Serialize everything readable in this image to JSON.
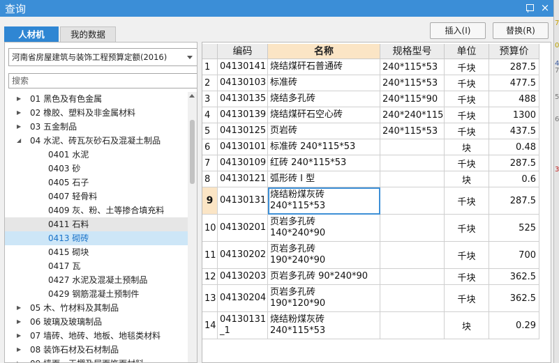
{
  "window": {
    "title": "查询",
    "close_glyph": "×"
  },
  "tabs": [
    {
      "label": "人材机"
    },
    {
      "label": "我的数据"
    }
  ],
  "buttons": {
    "insert": "插入(I)",
    "replace": "替换(R)"
  },
  "quota_select": {
    "value": "河南省房屋建筑与装饰工程预算定额(2016)"
  },
  "search": {
    "placeholder": "搜索"
  },
  "tree": [
    {
      "label": "01 黑色及有色金属",
      "level": 0,
      "state": ""
    },
    {
      "label": "02 橡胶、塑料及非金属材料",
      "level": 0,
      "state": ""
    },
    {
      "label": "03 五金制品",
      "level": 0,
      "state": ""
    },
    {
      "label": "04 水泥、砖瓦灰砂石及混凝土制品",
      "level": 0,
      "state": "expanded"
    },
    {
      "label": "0401 水泥",
      "level": 1,
      "state": ""
    },
    {
      "label": "0403 砂",
      "level": 1,
      "state": ""
    },
    {
      "label": "0405 石子",
      "level": 1,
      "state": ""
    },
    {
      "label": "0407 轻骨料",
      "level": 1,
      "state": ""
    },
    {
      "label": "0409 灰、粉、土等掺合填充料",
      "level": 1,
      "state": ""
    },
    {
      "label": "0411 石料",
      "level": 1,
      "state": "hover"
    },
    {
      "label": "0413 砌砖",
      "level": 1,
      "state": "selected"
    },
    {
      "label": "0415 砌块",
      "level": 1,
      "state": ""
    },
    {
      "label": "0417 瓦",
      "level": 1,
      "state": ""
    },
    {
      "label": "0427 水泥及混凝土预制品",
      "level": 1,
      "state": ""
    },
    {
      "label": "0429 钢筋混凝土预制件",
      "level": 1,
      "state": ""
    },
    {
      "label": "05 木、竹材料及其制品",
      "level": 0,
      "state": ""
    },
    {
      "label": "06 玻璃及玻璃制品",
      "level": 0,
      "state": ""
    },
    {
      "label": "07 墙砖、地砖、地板、地毯类材料",
      "level": 0,
      "state": ""
    },
    {
      "label": "08 装饰石材及石材制品",
      "level": 0,
      "state": ""
    },
    {
      "label": "09 墙面、天棚及屋面饰面材料",
      "level": 0,
      "state": ""
    }
  ],
  "grid": {
    "columns": [
      "",
      "编码",
      "名称",
      "规格型号",
      "单位",
      "预算价"
    ],
    "current_row": 9,
    "rows": [
      {
        "idx": "1",
        "code": "04130141",
        "name": "烧结煤矸石普通砖",
        "spec": "240*115*53",
        "unit": "千块",
        "price": "287.5"
      },
      {
        "idx": "2",
        "code": "04130103",
        "name": "标准砖",
        "spec": "240*115*53",
        "unit": "千块",
        "price": "477.5"
      },
      {
        "idx": "3",
        "code": "04130135",
        "name": "烧结多孔砖",
        "spec": "240*115*90",
        "unit": "千块",
        "price": "488"
      },
      {
        "idx": "4",
        "code": "04130139",
        "name": "烧结煤矸石空心砖",
        "spec": "240*240*115",
        "unit": "千块",
        "price": "1300"
      },
      {
        "idx": "5",
        "code": "04130125",
        "name": "页岩砖",
        "spec": "240*115*53",
        "unit": "千块",
        "price": "437.5"
      },
      {
        "idx": "6",
        "code": "04130101",
        "name": "标准砖 240*115*53",
        "spec": "",
        "unit": "块",
        "price": "0.48"
      },
      {
        "idx": "7",
        "code": "04130109",
        "name": "红砖 240*115*53",
        "spec": "",
        "unit": "千块",
        "price": "287.5"
      },
      {
        "idx": "8",
        "code": "04130121",
        "name": "弧形砖 I 型",
        "spec": "",
        "unit": "块",
        "price": "0.6"
      },
      {
        "idx": "9",
        "code": "04130131",
        "name": "烧结粉煤灰砖\n240*115*53",
        "spec": "",
        "unit": "千块",
        "price": "287.5"
      },
      {
        "idx": "10",
        "code": "04130201",
        "name": "页岩多孔砖\n140*240*90",
        "spec": "",
        "unit": "千块",
        "price": "525"
      },
      {
        "idx": "11",
        "code": "04130202",
        "name": "页岩多孔砖\n190*240*90",
        "spec": "",
        "unit": "千块",
        "price": "700"
      },
      {
        "idx": "12",
        "code": "04130203",
        "name": "页岩多孔砖 90*240*90",
        "spec": "",
        "unit": "千块",
        "price": "362.5"
      },
      {
        "idx": "13",
        "code": "04130204",
        "name": "页岩多孔砖\n190*120*90",
        "spec": "",
        "unit": "千块",
        "price": "362.5"
      },
      {
        "idx": "14",
        "code": "04130131\n_1",
        "name": "烧结粉煤灰砖\n240*115*53",
        "spec": "",
        "unit": "块",
        "price": "0.29"
      }
    ]
  },
  "side_strip": {
    "marks": [
      "7",
      "0",
      "4",
      "7",
      "5",
      "6",
      "3"
    ]
  }
}
